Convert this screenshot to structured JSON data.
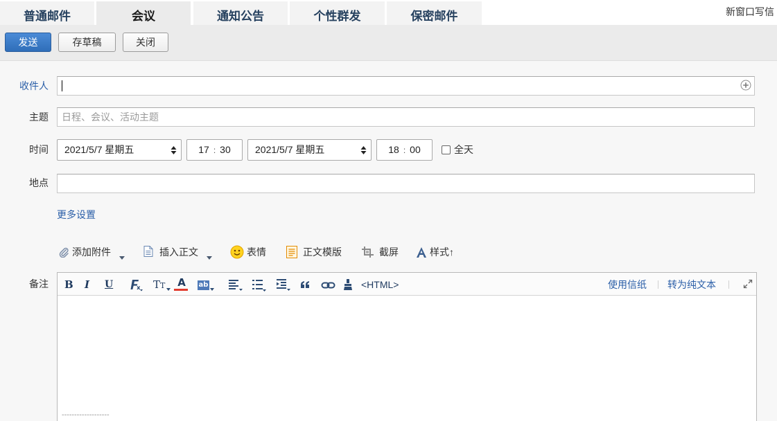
{
  "tabs": [
    {
      "label": "普通邮件",
      "active": false
    },
    {
      "label": "会议",
      "active": true
    },
    {
      "label": "通知公告",
      "active": false
    },
    {
      "label": "个性群发",
      "active": false
    },
    {
      "label": "保密邮件",
      "active": false
    }
  ],
  "header": {
    "new_window": "新窗口写信"
  },
  "toolbar": {
    "send": "发送",
    "save_draft": "存草稿",
    "close": "关闭"
  },
  "form": {
    "recipient": {
      "label": "收件人",
      "value": ""
    },
    "subject": {
      "label": "主题",
      "placeholder": "日程、会议、活动主题",
      "value": ""
    },
    "time": {
      "label": "时间",
      "start": {
        "date": "2021/5/7 星期五",
        "hour": "17",
        "minute": "30"
      },
      "end": {
        "date": "2021/5/7 星期五",
        "hour": "18",
        "minute": "00"
      },
      "separator": ":",
      "all_day": {
        "label": "全天",
        "checked": false
      }
    },
    "location": {
      "label": "地点",
      "value": ""
    },
    "more_settings": "更多设置"
  },
  "compose_tools": {
    "add_attachment": "添加附件",
    "insert_body": "插入正文",
    "emoji": "表情",
    "template": "正文模版",
    "screenshot": "截屏",
    "style": "样式↑"
  },
  "editor": {
    "label": "备注",
    "glyphs": {
      "bold": "B",
      "italic": "I",
      "underline": "U",
      "font_size": "T",
      "font_color": "A",
      "highlight": "ab"
    },
    "html_mode": "<HTML>",
    "stationery": "使用信纸",
    "plain_text": "转为纯文本",
    "signature_separator": "-------------------"
  },
  "colors": {
    "accent": "#2f6eb9",
    "link": "#2b5fa8",
    "tab_text": "#26415f",
    "toolbar_bg": "#ebebeb",
    "page_bg": "#f7f7f7",
    "font_color_bar": "#e23b2e",
    "highlight_bg": "#4e79b8"
  },
  "icons": {
    "add_recipient": "plus-circle-icon",
    "date_select": "select-arrows-icon",
    "attachment": "paperclip-icon",
    "insert_body": "document-icon",
    "emoji": "smiley-icon",
    "template": "template-icon",
    "screenshot": "screenshot-icon",
    "style": "style-letter-icon",
    "clear_format": "clear-format-icon",
    "align": "align-icon",
    "list": "list-icon",
    "indent": "indent-icon",
    "quote": "quote-icon",
    "link": "link-icon",
    "format_painter": "format-painter-icon",
    "expand": "expand-icon"
  }
}
